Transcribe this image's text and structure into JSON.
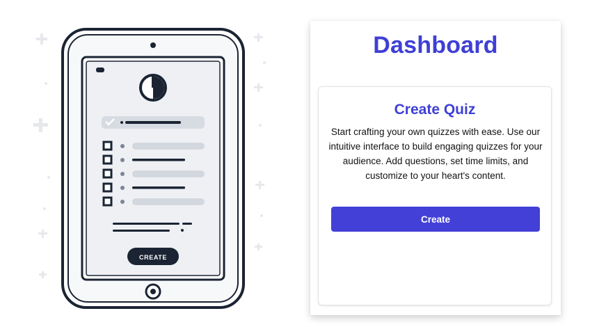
{
  "illustration": {
    "button_label": "CREATE",
    "icon": "tablet-quiz-illustration"
  },
  "dashboard": {
    "title": "Dashboard",
    "card": {
      "title": "Create Quiz",
      "description": "Start crafting your own quizzes with ease. Use our intuitive interface to build engaging quizzes for your audience. Add questions, set time limits, and customize to your heart's content.",
      "button_label": "Create"
    }
  },
  "colors": {
    "accent": "#3f3fd6",
    "button": "#4340d8",
    "illustration_dark": "#1b2433"
  }
}
